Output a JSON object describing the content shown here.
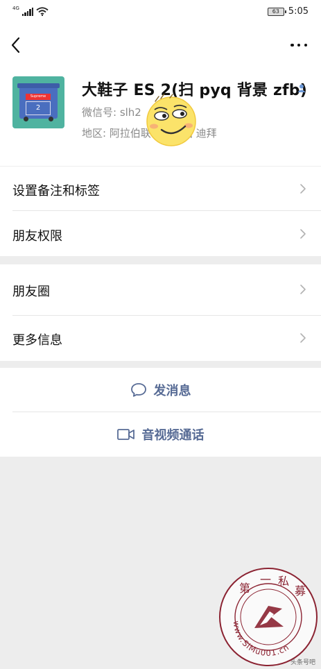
{
  "status_bar": {
    "network": "4G",
    "battery": "63",
    "time": "5:05"
  },
  "profile": {
    "name": "大鞋子 ES 2(扫 pyq 背景 zfb)",
    "wechat_id": "微信号: slh2",
    "region": "地区: 阿拉伯联合酋长国 迪拜",
    "avatar_bin_label": "Supreme",
    "avatar_bin_number": "2"
  },
  "settings": {
    "remarks_tags": "设置备注和标签",
    "permissions": "朋友权限",
    "moments": "朋友圈",
    "more_info": "更多信息"
  },
  "actions": {
    "send_message": "发消息",
    "video_call": "音视频通话"
  },
  "watermark": {
    "chars": [
      "第",
      "一",
      "私",
      "募"
    ],
    "url": "www.SiMu001.cn",
    "corner_text": "头条号吧"
  },
  "colors": {
    "accent": "#576b95",
    "background": "#ededed",
    "watermark": "#8b2332"
  }
}
